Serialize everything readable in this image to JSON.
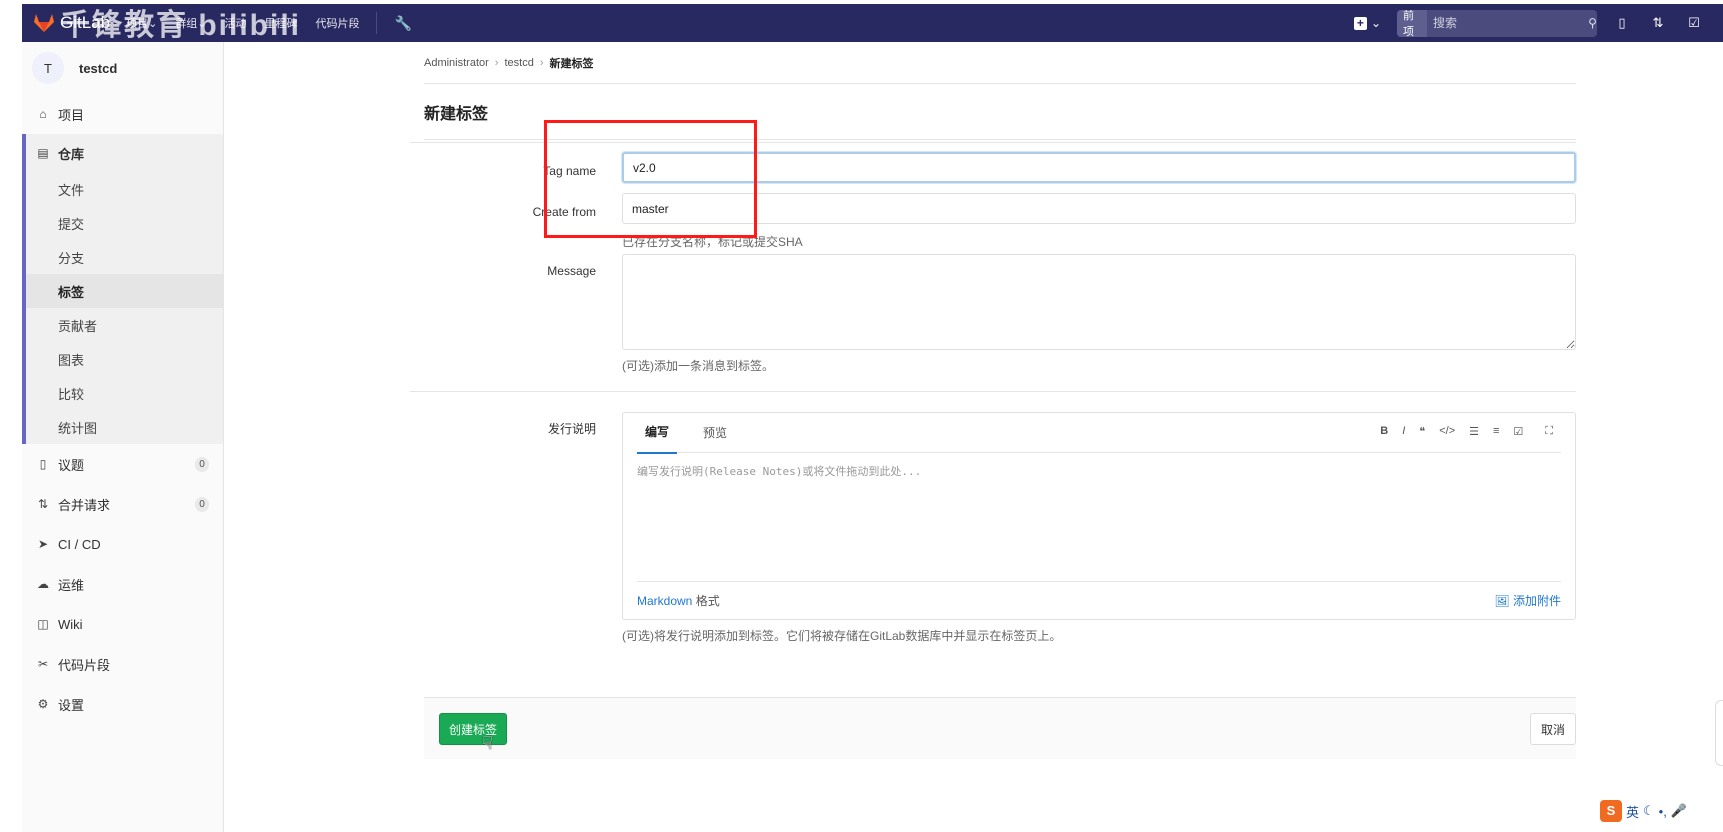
{
  "watermark": "千锋教育 bilibili",
  "navbar": {
    "brand": "GitLab",
    "menu": [
      "项目",
      "群组",
      "活动",
      "里程碑",
      "代码片段"
    ],
    "search_scope": "当前项目",
    "search_placeholder": "搜索"
  },
  "sidebar": {
    "avatar_letter": "T",
    "project_name": "testcd",
    "items": [
      {
        "label": "项目"
      },
      {
        "label": "仓库"
      },
      {
        "label": "议题",
        "badge": "0"
      },
      {
        "label": "合并请求",
        "badge": "0"
      },
      {
        "label": "CI / CD"
      },
      {
        "label": "运维"
      },
      {
        "label": "Wiki"
      },
      {
        "label": "代码片段"
      },
      {
        "label": "设置"
      }
    ],
    "repo_sub": [
      "文件",
      "提交",
      "分支",
      "标签",
      "贡献者",
      "图表",
      "比较",
      "统计图"
    ]
  },
  "breadcrumb": [
    "Administrator",
    "testcd",
    "新建标签"
  ],
  "page_title": "新建标签",
  "form": {
    "tag_name_label": "Tag name",
    "tag_name_value": "v2.0",
    "create_from_label": "Create from",
    "create_from_value": "master",
    "create_from_help": "已存在分支名称，标记或提交SHA",
    "message_label": "Message",
    "message_help": "(可选)添加一条消息到标签。",
    "release_label": "发行说明",
    "release_tabs": [
      "编写",
      "预览"
    ],
    "release_placeholder": "编写发行说明(Release Notes)或将文件拖动到此处...",
    "markdown_link": "Markdown",
    "markdown_suffix": "格式",
    "attach_label": "添加附件",
    "release_help": "(可选)将发行说明添加到标签。它们将被存储在GitLab数据库中并显示在标签页上。"
  },
  "actions": {
    "create": "创建标签",
    "cancel": "取消"
  },
  "ime": {
    "lang": "英"
  },
  "colors": {
    "navbar": "#292961",
    "create_button": "#1aaa55",
    "highlight_box": "#ff1a1a",
    "active_border": "#6666c4"
  }
}
